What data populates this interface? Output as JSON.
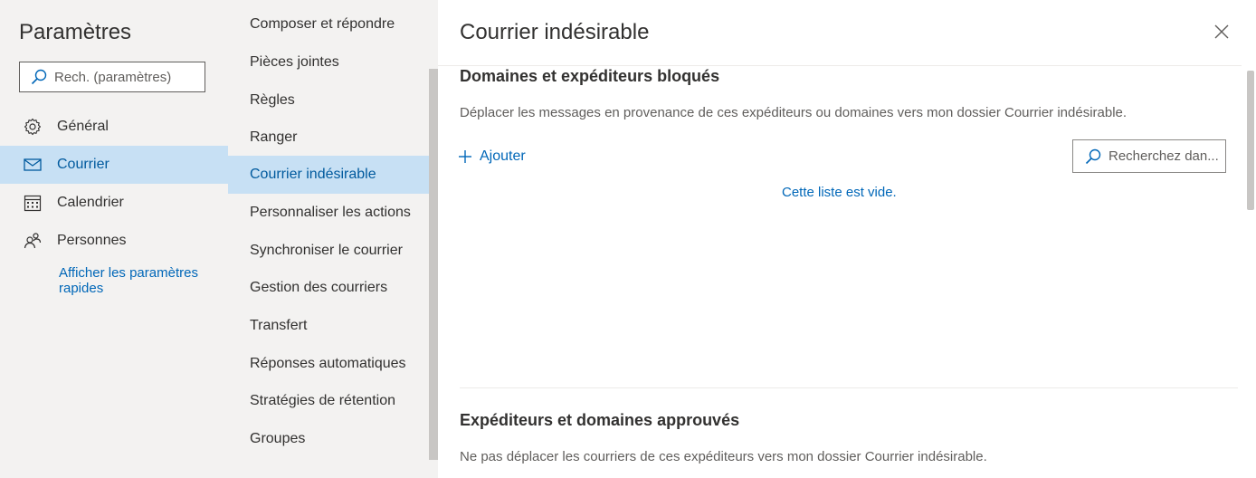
{
  "sidebar": {
    "title": "Paramètres",
    "search_placeholder": "Rech. (paramètres)",
    "items": [
      {
        "label": "Général",
        "icon": "gear-icon"
      },
      {
        "label": "Courrier",
        "icon": "mail-icon"
      },
      {
        "label": "Calendrier",
        "icon": "calendar-icon"
      },
      {
        "label": "Personnes",
        "icon": "people-icon"
      }
    ],
    "active_item": "Courrier",
    "quick_settings_link": "Afficher les paramètres rapides"
  },
  "submenu": {
    "items": [
      "Composer et répondre",
      "Pièces jointes",
      "Règles",
      "Ranger",
      "Courrier indésirable",
      "Personnaliser les actions",
      "Synchroniser le courrier",
      "Gestion des courriers",
      "Transfert",
      "Réponses automatiques",
      "Stratégies de rétention",
      "Groupes"
    ],
    "active_item": "Courrier indésirable"
  },
  "pane": {
    "title": "Courrier indésirable",
    "blocked": {
      "title": "Domaines et expéditeurs bloqués",
      "description": "Déplacer les messages en provenance de ces expéditeurs ou domaines vers mon dossier Courrier indésirable.",
      "add_label": "Ajouter",
      "search_placeholder": "Recherchez dan...",
      "empty_message": "Cette liste est vide."
    },
    "approved": {
      "title": "Expéditeurs et domaines approuvés",
      "description": "Ne pas déplacer les courriers de ces expéditeurs vers mon dossier Courrier indésirable."
    }
  },
  "colors": {
    "accent": "#0067b8",
    "selected_bg": "#c7e0f4",
    "sidebar_bg": "#f3f2f1"
  }
}
